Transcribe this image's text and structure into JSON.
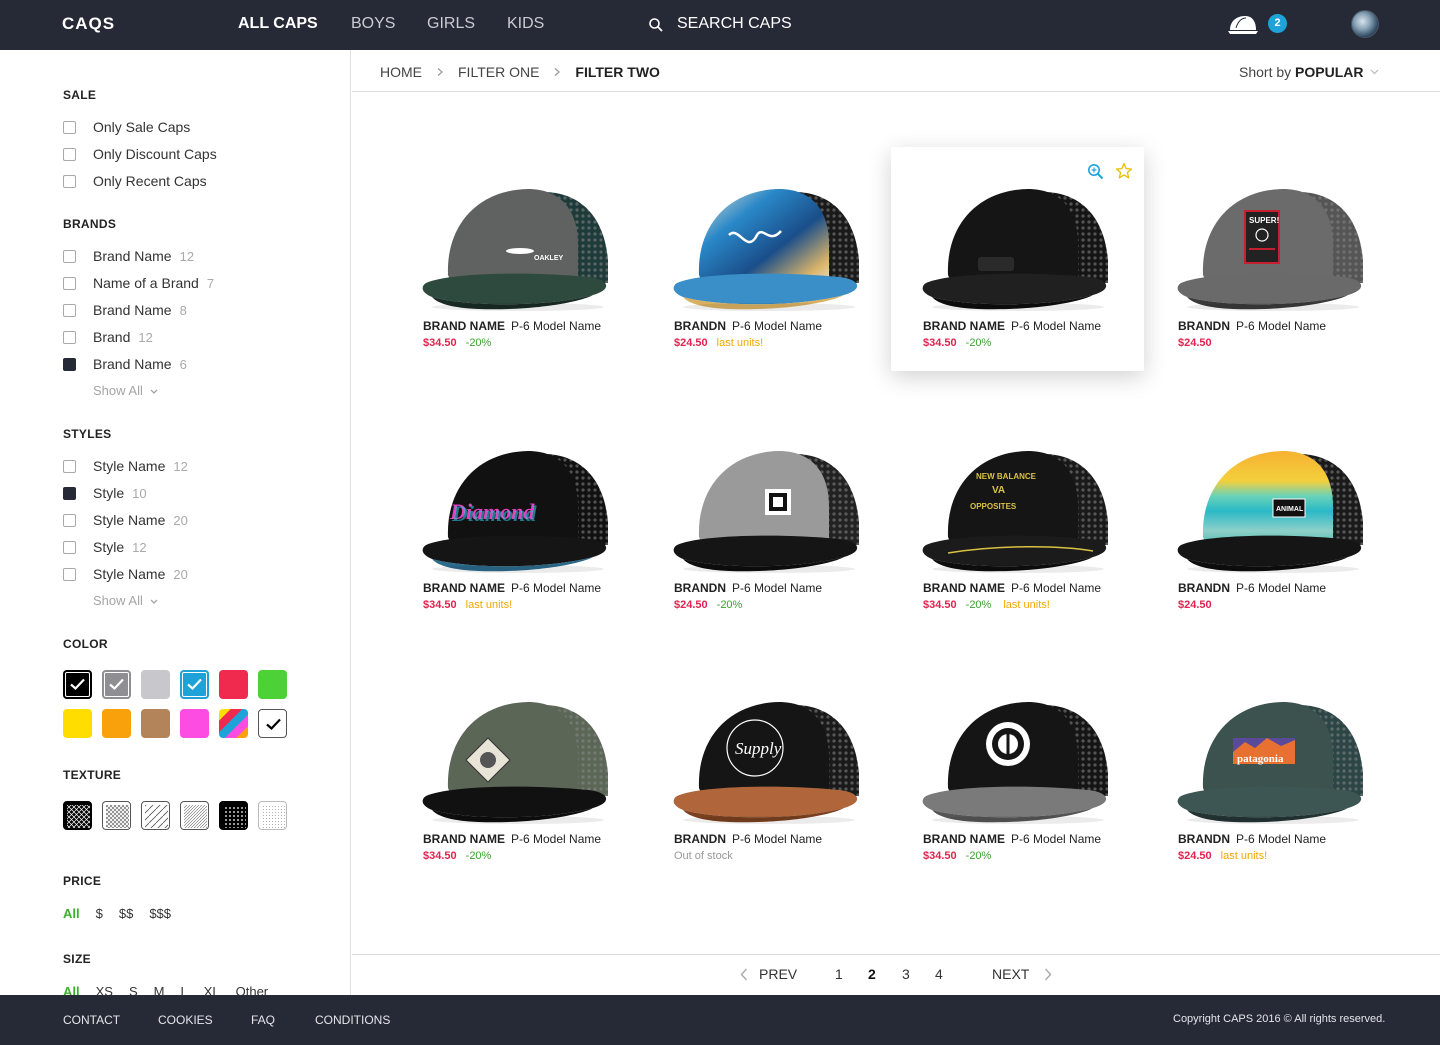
{
  "header": {
    "logo": "CAQS",
    "nav": [
      "ALL CAPS",
      "BOYS",
      "GIRLS",
      "KIDS"
    ],
    "search_placeholder": "SEARCH CAPS",
    "cart_count": "2"
  },
  "sidebar": {
    "sale": {
      "title": "SALE",
      "items": [
        {
          "label": "Only Sale Caps"
        },
        {
          "label": "Only Discount Caps"
        },
        {
          "label": "Only Recent Caps"
        }
      ]
    },
    "brands": {
      "title": "BRANDS",
      "items": [
        {
          "label": "Brand Name",
          "count": "12",
          "checked": false
        },
        {
          "label": "Name of a Brand",
          "count": "7",
          "checked": false
        },
        {
          "label": "Brand Name",
          "count": "8",
          "checked": false
        },
        {
          "label": "Brand",
          "count": "12",
          "checked": false
        },
        {
          "label": "Brand Name",
          "count": "6",
          "checked": true
        }
      ],
      "show_all": "Show All"
    },
    "styles": {
      "title": "STYLES",
      "items": [
        {
          "label": "Style Name",
          "count": "12",
          "checked": false
        },
        {
          "label": "Style",
          "count": "10",
          "checked": true
        },
        {
          "label": "Style Name",
          "count": "20",
          "checked": false
        },
        {
          "label": "Style",
          "count": "12",
          "checked": false
        },
        {
          "label": "Style Name",
          "count": "20",
          "checked": false
        }
      ],
      "show_all": "Show All"
    },
    "color": {
      "title": "COLOR",
      "swatches": [
        {
          "color": "#000000",
          "selected": true
        },
        {
          "color": "#8e8e93",
          "selected": true
        },
        {
          "color": "#c7c7cc",
          "selected": false
        },
        {
          "color": "#1ea3d8",
          "selected": true
        },
        {
          "color": "#f0294e",
          "selected": false
        },
        {
          "color": "#4cd137",
          "selected": false
        },
        {
          "color": "#ffdd00",
          "selected": false
        },
        {
          "color": "#f9a10a",
          "selected": false
        },
        {
          "color": "#b3835a",
          "selected": false
        },
        {
          "color": "#fd4ce1",
          "selected": false
        },
        {
          "color": "multicolor",
          "selected": false
        },
        {
          "color": "#ffffff",
          "selected": true
        }
      ]
    },
    "texture": {
      "title": "TEXTURE",
      "items": [
        "crosshatch-dark",
        "crosshatch",
        "diagonal-wide",
        "diagonal-thin",
        "dots-dark",
        "dots-light"
      ]
    },
    "price": {
      "title": "PRICE",
      "options": [
        "All",
        "$",
        "$$",
        "$$$"
      ]
    },
    "size": {
      "title": "SIZE",
      "options": [
        "All",
        "XS",
        "S",
        "M",
        "L",
        "XL",
        "Other"
      ]
    }
  },
  "breadcrumb": [
    "HOME",
    "FILTER ONE",
    "FILTER TWO"
  ],
  "sort": {
    "prefix": "Short by",
    "value": "POPULAR"
  },
  "products": [
    {
      "brand": "BRAND NAME",
      "model": "P-6 Model Name",
      "price": "$34.50",
      "discount": "-20%",
      "note": "",
      "style": "oakley"
    },
    {
      "brand": "BRANDN",
      "model": "P-6 Model Name",
      "price": "$24.50",
      "discount": "",
      "note": "last units!",
      "style": "wave"
    },
    {
      "brand": "BRAND NAME",
      "model": "P-6 Model Name",
      "price": "$34.50",
      "discount": "-20%",
      "note": "",
      "style": "black-back"
    },
    {
      "brand": "BRANDN",
      "model": "P-6 Model Name",
      "price": "$24.50",
      "discount": "",
      "note": "",
      "style": "super"
    },
    {
      "brand": "BRAND NAME",
      "model": "P-6 Model Name",
      "price": "$34.50",
      "discount": "",
      "note": "last units!",
      "style": "diamond"
    },
    {
      "brand": "BRANDN",
      "model": "P-6 Model Name",
      "price": "$24.50",
      "discount": "-20%",
      "note": "",
      "style": "dc"
    },
    {
      "brand": "BRAND NAME",
      "model": "P-6 Model Name",
      "price": "$34.50",
      "discount": "-20%",
      "note": "last units!",
      "style": "rvca"
    },
    {
      "brand": "BRANDN",
      "model": "P-6 Model Name",
      "price": "$24.50",
      "discount": "",
      "note": "",
      "style": "animal"
    },
    {
      "brand": "BRAND NAME",
      "model": "P-6 Model Name",
      "price": "$34.50",
      "discount": "-20%",
      "note": "",
      "style": "olive"
    },
    {
      "brand": "BRANDN",
      "model": "P-6 Model Name",
      "price": "",
      "discount": "",
      "note": "Out of stock",
      "style": "supply"
    },
    {
      "brand": "BRAND NAME",
      "model": "P-6 Model Name",
      "price": "$34.50",
      "discount": "-20%",
      "note": "",
      "style": "element"
    },
    {
      "brand": "BRANDN",
      "model": "P-6 Model Name",
      "price": "$24.50",
      "discount": "",
      "note": "last units!",
      "style": "patagonia"
    }
  ],
  "pagination": {
    "prev": "PREV",
    "next": "NEXT",
    "pages": [
      "1",
      "2",
      "3",
      "4"
    ],
    "current": "2"
  },
  "footer": {
    "links": [
      "CONTACT",
      "COOKIES",
      "FAQ",
      "CONDITIONS"
    ],
    "copyright": "Copyright CAPS 2016 ©  All rights reserved."
  }
}
